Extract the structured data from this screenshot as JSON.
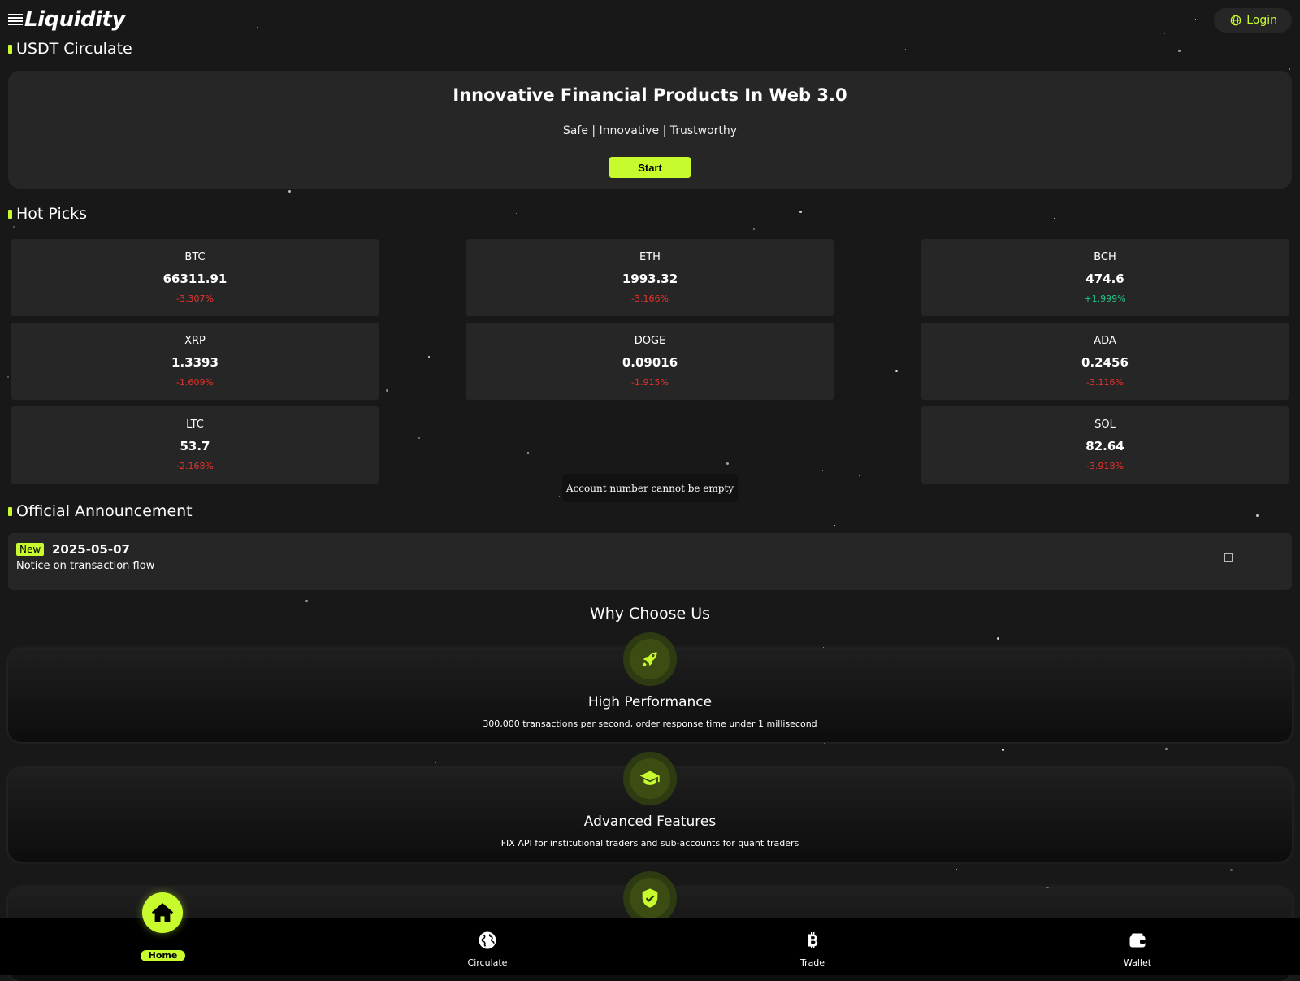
{
  "header": {
    "logo": "Liquidity",
    "login_label": "Login"
  },
  "sections": {
    "usdt": "USDT Circulate",
    "hot": "Hot Picks",
    "announce": "Official Announcement"
  },
  "hero": {
    "title": "Innovative Financial Products In Web 3.0",
    "subtitle": "Safe | Innovative | Trustworthy",
    "button": "Start"
  },
  "tickers": [
    {
      "symbol": "BTC",
      "price": "66311.91",
      "change": "-3.307%"
    },
    {
      "symbol": "ETH",
      "price": "1993.32",
      "change": "-3.166%"
    },
    {
      "symbol": "BCH",
      "price": "474.6",
      "change": "+1.999%"
    },
    {
      "symbol": "XRP",
      "price": "1.3393",
      "change": "-1.609%"
    },
    {
      "symbol": "DOGE",
      "price": "0.09016",
      "change": "-1.915%"
    },
    {
      "symbol": "ADA",
      "price": "0.2456",
      "change": "-3.116%"
    },
    {
      "symbol": "LTC",
      "price": "53.7",
      "change": "-2.168%"
    },
    {
      "symbol": "SOL",
      "price": "82.64",
      "change": "-3.918%"
    }
  ],
  "toast": "Account number cannot be empty",
  "announcement": {
    "badge": "New",
    "date": "2025-05-07",
    "title": "Notice on transaction flow"
  },
  "why": {
    "title": "Why Choose Us",
    "features": [
      {
        "title": "High Performance",
        "desc": "300,000 transactions per second, order response time under 1 millisecond",
        "icon": "rocket-icon"
      },
      {
        "title": "Advanced Features",
        "desc": "FIX API for institutional traders and sub-accounts for quant traders",
        "icon": "graduation-cap-icon"
      },
      {
        "title": "",
        "desc": "",
        "icon": "shield-check-icon"
      }
    ]
  },
  "nav": {
    "home": "Home",
    "circulate": "Circulate",
    "trade": "Trade",
    "wallet": "Wallet"
  },
  "colors": {
    "accent": "#c8fb2d",
    "negative": "#e5322e",
    "positive": "#1ec98a",
    "panel": "#262626",
    "background": "#181818"
  }
}
